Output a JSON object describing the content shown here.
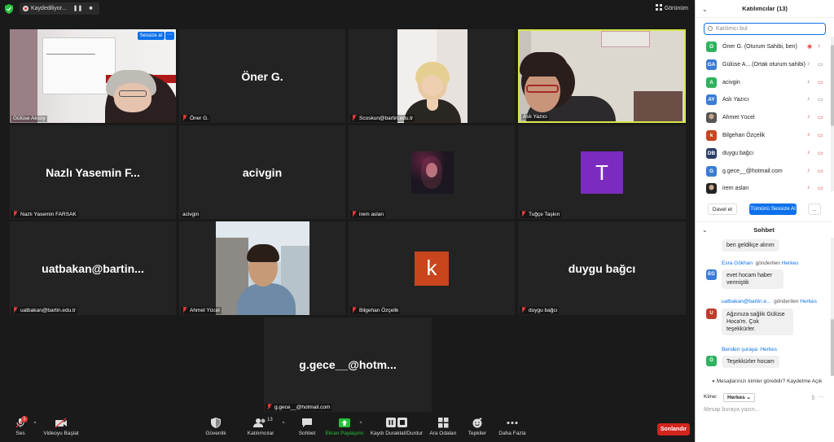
{
  "topbar": {
    "recording_label": "Kaydediliyor...",
    "pause_icon": "pause-icon",
    "stop_icon": "stop-icon",
    "view_label": "Görünüm"
  },
  "tiles": [
    {
      "name": "Gülüse Aksoy",
      "type": "video",
      "mute_badge": "Sessize al"
    },
    {
      "name": "Öner G.",
      "display": "Öner G.",
      "type": "name",
      "muted": true
    },
    {
      "name": "Scoskun@bartin.edu.tr",
      "type": "video",
      "muted": true
    },
    {
      "name": "Aslı Yazıcı",
      "type": "video",
      "active": true
    },
    {
      "name": "Nazlı Yasemin FARSAK",
      "display": "Nazlı Yasemin F...",
      "type": "name",
      "muted": true
    },
    {
      "name": "acivgin",
      "display": "acivgin",
      "type": "name",
      "muted": false
    },
    {
      "name": "irem aslan",
      "type": "photo",
      "muted": true
    },
    {
      "name": "Tuğçe Taşkın",
      "type": "avatar",
      "letter": "T",
      "color": "#7b2cbf",
      "muted": true
    },
    {
      "name": "uatbakan@bartin.edu.tr",
      "display": "uatbakan@bartin...",
      "type": "name",
      "muted": true
    },
    {
      "name": "Ahmet Yücel",
      "type": "video",
      "muted": true
    },
    {
      "name": "Bilgehan Özçelik",
      "type": "avatar",
      "letter": "k",
      "color": "#c8451d",
      "muted": true
    },
    {
      "name": "duygu bağcı",
      "display": "duygu bağcı",
      "type": "name",
      "muted": true
    },
    {
      "name": "g.gece__@hotmail.com",
      "display": "g.gece__@hotm...",
      "type": "name",
      "muted": true
    }
  ],
  "toolbar": {
    "audio": "Ses",
    "audio_badge": "1",
    "video": "Videoyu Başlat",
    "security": "Güvenlik",
    "participants": "Katılımcılar",
    "participants_count": "13",
    "chat": "Sohbet",
    "share": "Ekran Paylaşımı",
    "record": "Kaydı Duraklat/Durdur",
    "breakout": "Ara Odaları",
    "reactions": "Tepkiler",
    "more": "Daha Fazla",
    "end": "Sonlandır",
    "share_color": "#25c13a",
    "end_color": "#d3241d"
  },
  "participants_panel": {
    "title": "Katılımcılar (13)",
    "search_placeholder": "Katılımcı bul",
    "items": [
      {
        "initials": "Ö",
        "color": "#2db35d",
        "name": "Öner G. (Oturum Sahibi, ben)",
        "icons": [
          "record-icon",
          "mic-muted-icon"
        ]
      },
      {
        "initials": "GA",
        "color": "#3a7bd5",
        "name": "Gülüse A... (Ortak oturum sahibi)",
        "icons": [
          "mic-icon",
          "video-icon"
        ]
      },
      {
        "initials": "A",
        "color": "#2db35d",
        "name": "acivgin",
        "icons": [
          "mic-icon",
          "video-off-icon"
        ]
      },
      {
        "initials": "AY",
        "color": "#3a7bd5",
        "name": "Aslı Yazıcı",
        "icons": [
          "mic-icon",
          "video-icon"
        ]
      },
      {
        "initials": "",
        "color": "#555",
        "name": "Ahmet Yücel",
        "photo": true,
        "icons": [
          "mic-muted-icon",
          "video-off-icon"
        ]
      },
      {
        "initials": "k",
        "color": "#c8451d",
        "name": "Bilgehan Özçelik",
        "icons": [
          "mic-muted-icon",
          "video-off-icon"
        ]
      },
      {
        "initials": "DB",
        "color": "#2c3e66",
        "name": "duygu bağcı",
        "icons": [
          "mic-muted-icon",
          "video-off-icon"
        ]
      },
      {
        "initials": "G",
        "color": "#3a7bd5",
        "name": "g.gece__@hotmail.com",
        "icons": [
          "mic-muted-icon",
          "video-off-icon"
        ]
      },
      {
        "initials": "",
        "color": "#222",
        "name": "irem aslan",
        "photo": true,
        "icons": [
          "mic-muted-icon",
          "video-off-icon"
        ]
      }
    ],
    "invite": "Davet et",
    "mute_all": "Tümünü Sessize Al",
    "more": "..."
  },
  "chat_panel": {
    "title": "Sohbet",
    "messages": [
      {
        "sender": "",
        "text": "ben geldikçe alırım"
      },
      {
        "sender": "Esra Gökhan",
        "initials": "EG",
        "color": "#3a7bd5",
        "to_prefix": "gönderilen",
        "to": "Herkes",
        "text": "evet hocam haber vermiştik"
      },
      {
        "sender": "uatbakan@bartin.e...",
        "initials": "U",
        "color": "#c0392b",
        "to_prefix": "gönderilen",
        "to": "Herkes",
        "text": "Ağzınıza sağlık Gülüse Hoca'm. Çok teşekkürler."
      },
      {
        "sender": "Benden şuraya:",
        "initials": "Ö",
        "color": "#2db35d",
        "to_prefix": "",
        "to": "Herkes",
        "text": "Teşekkürler hocam"
      }
    ],
    "who_can_see": "Mesajlarınızı kimler görebilir? Kaydetme Açık",
    "to_label": "Kime:",
    "to_value": "Herkes",
    "input_placeholder": "Mesajı buraya yazın..."
  }
}
